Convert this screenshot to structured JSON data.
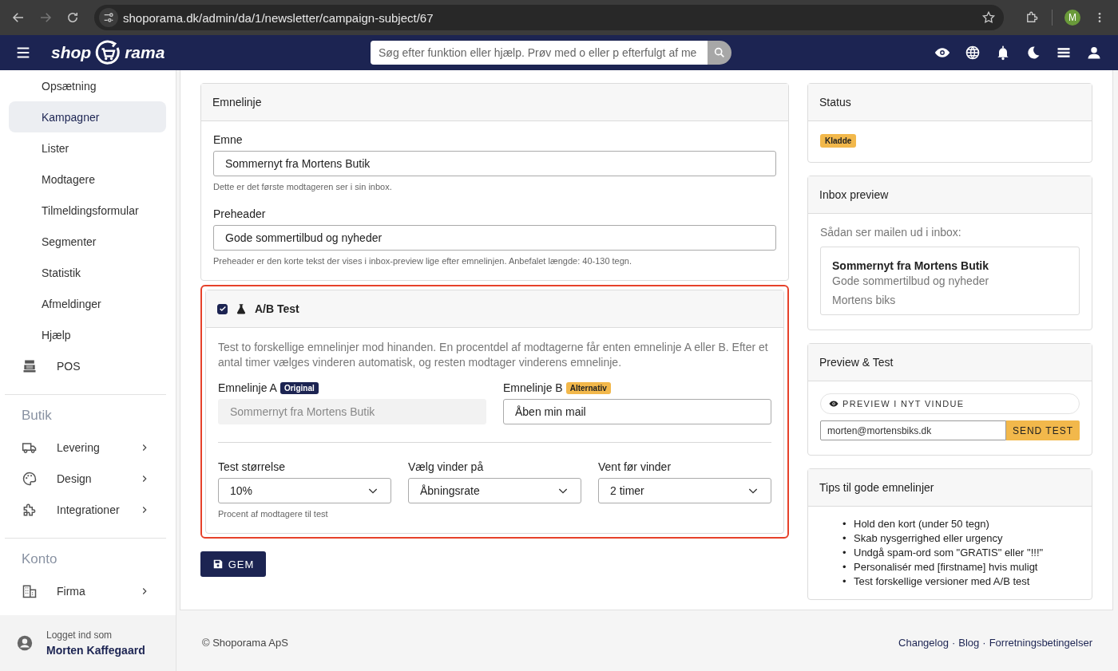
{
  "browser": {
    "url": "shoporama.dk/admin/da/1/newsletter/campaign-subject/67",
    "can_go_forward": false,
    "profile_initial": "M"
  },
  "header": {
    "logo_left": "shop",
    "logo_right": "rama",
    "search": {
      "placeholder": "Søg efter funktion eller hjælp. Prøv med o eller p efterfulgt af me"
    }
  },
  "sidebar": {
    "sections": [
      {
        "items": [
          {
            "label": "Opsætning",
            "kind": "subitem",
            "selected": false,
            "expandable": false
          },
          {
            "label": "Kampagner",
            "kind": "subitem",
            "selected": true,
            "expandable": false
          },
          {
            "label": "Lister",
            "kind": "subitem",
            "selected": false,
            "expandable": false
          },
          {
            "label": "Modtagere",
            "kind": "subitem",
            "selected": false,
            "expandable": false
          },
          {
            "label": "Tilmeldingsformular",
            "kind": "subitem",
            "selected": false,
            "expandable": false
          },
          {
            "label": "Segmenter",
            "kind": "subitem",
            "selected": false,
            "expandable": false
          },
          {
            "label": "Statistik",
            "kind": "subitem",
            "selected": false,
            "expandable": false
          },
          {
            "label": "Afmeldinger",
            "kind": "subitem",
            "selected": false,
            "expandable": false
          },
          {
            "label": "Hjælp",
            "kind": "subitem",
            "selected": false,
            "expandable": false
          },
          {
            "label": "POS",
            "kind": "register",
            "selected": false,
            "expandable": false
          }
        ]
      },
      {
        "heading": "Butik",
        "items": [
          {
            "label": "Levering",
            "kind": "truck",
            "selected": false,
            "expandable": true
          },
          {
            "label": "Design",
            "kind": "palette",
            "selected": false,
            "expandable": true
          },
          {
            "label": "Integrationer",
            "kind": "puzzle",
            "selected": false,
            "expandable": true
          }
        ]
      },
      {
        "heading": "Konto",
        "items": [
          {
            "label": "Firma",
            "kind": "building",
            "selected": false,
            "expandable": true
          }
        ]
      }
    ],
    "user": {
      "caption": "Logget ind som",
      "name": "Morten Kaffegaard"
    }
  },
  "subject_card": {
    "title": "Emnelinje",
    "fields": [
      {
        "label": "Emne",
        "value": "Sommernyt fra Mortens Butik",
        "help": "Dette er det første modtageren ser i sin inbox."
      },
      {
        "label": "Preheader",
        "value": "Gode sommertilbud og nyheder",
        "help": "Preheader er den korte tekst der vises i inbox-preview lige efter emnelinjen. Anbefalet længde: 40-130 tegn."
      }
    ]
  },
  "ab_card": {
    "highlighted": true,
    "checked": true,
    "title": "A/B Test",
    "description": "Test to forskellige emnelinjer mod hinanden. En procentdel af modtagerne får enten emnelinje A eller B. Efter et antal timer vælges vinderen automatisk, og resten modtager vinderens emnelinje.",
    "variants": [
      {
        "label": "Emnelinje A",
        "badge": "Original",
        "kind": "primary",
        "value": "Sommernyt fra Mortens Butik",
        "disabled": true
      },
      {
        "label": "Emnelinje B",
        "badge": "Alternativ",
        "kind": "warning",
        "value": "Åben min mail",
        "disabled": false
      }
    ],
    "selects": [
      {
        "label": "Test størrelse",
        "value": "10%",
        "help": "Procent af modtagere til test"
      },
      {
        "label": "Vælg vinder på",
        "value": "Åbningsrate"
      },
      {
        "label": "Vent før vinder",
        "value": "2 timer"
      }
    ]
  },
  "save_button": "GEM",
  "status_card": {
    "title": "Status",
    "badge": "Kladde"
  },
  "inbox_card": {
    "title": "Inbox preview",
    "intro": "Sådan ser mailen ud i inbox:",
    "subject": "Sommernyt fra Mortens Butik",
    "preheader": "Gode sommertilbud og nyheder",
    "sender": "Mortens biks"
  },
  "preview_card": {
    "title": "Preview & Test",
    "preview_button": "PREVIEW I NYT VINDUE",
    "email": "morten@mortensbiks.dk",
    "send_button": "SEND TEST"
  },
  "tips_card": {
    "title": "Tips til gode emnelinjer",
    "items": [
      {
        "bullet": "•",
        "text": "Hold den kort (under 50 tegn)"
      },
      {
        "bullet": "•",
        "text": "Skab nysgerrighed eller urgency"
      },
      {
        "bullet": "•",
        "text": "Undgå spam-ord som \"GRATIS\" eller \"!!!\""
      },
      {
        "bullet": "•",
        "text": "Personalisér med [firstname] hvis muligt"
      },
      {
        "bullet": "•",
        "text": "Test forskellige versioner med A/B test"
      }
    ]
  },
  "footer": {
    "copyright": "© Shoporama ApS",
    "links": [
      "Changelog",
      "Blog",
      "Forretningsbetingelser"
    ],
    "separators": [
      "·",
      "·"
    ]
  }
}
